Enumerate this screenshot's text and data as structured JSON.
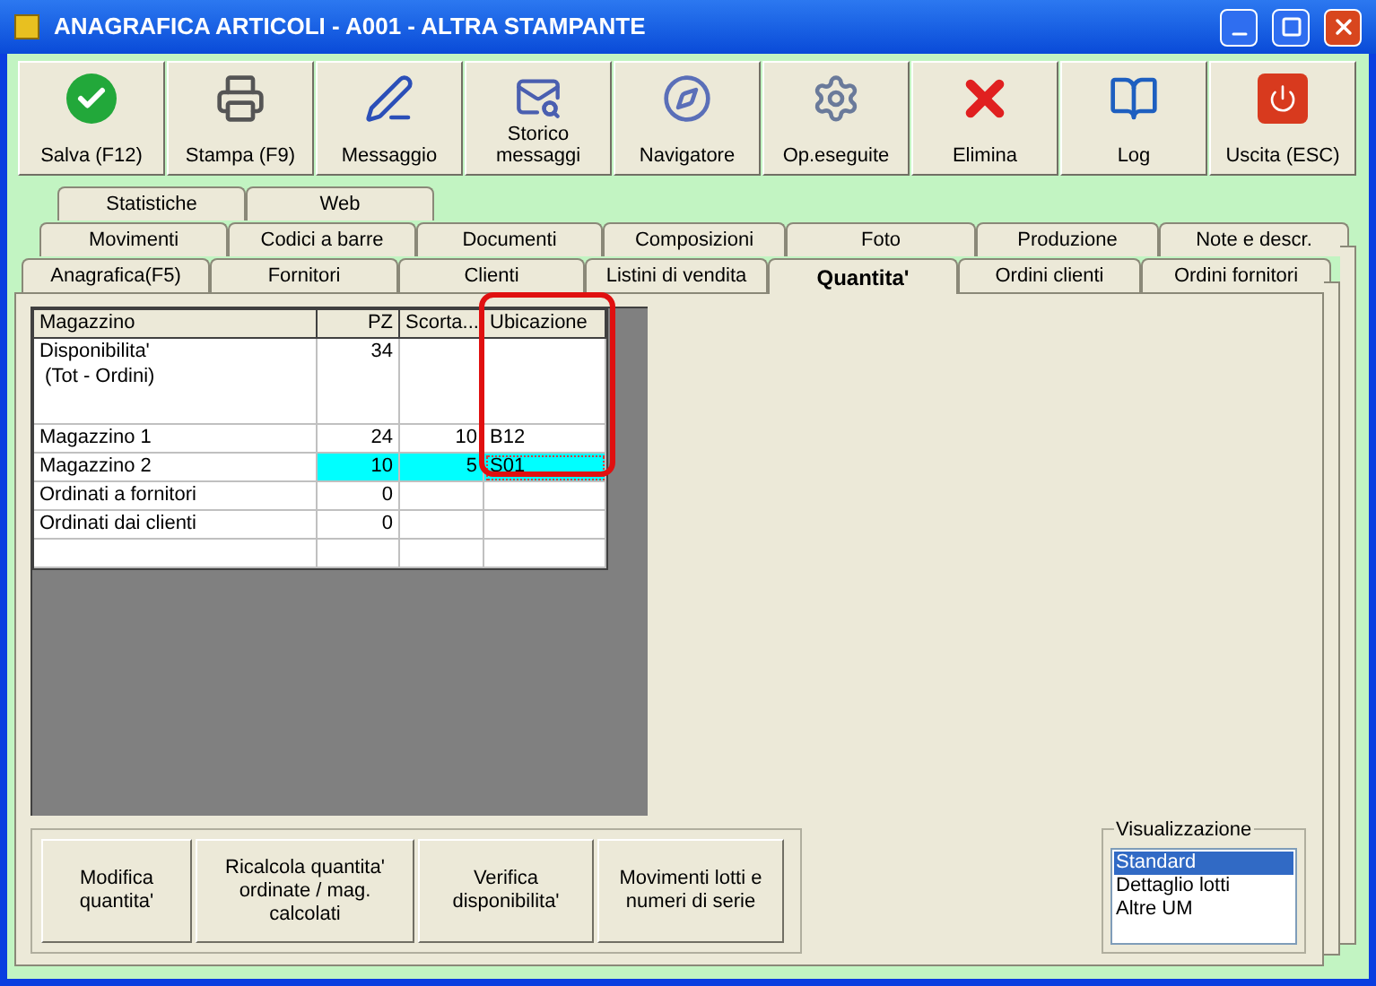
{
  "window": {
    "title": "ANAGRAFICA ARTICOLI - A001 - ALTRA STAMPANTE"
  },
  "toolbar": [
    {
      "label": "Salva (F12)"
    },
    {
      "label": "Stampa (F9)"
    },
    {
      "label": "Messaggio"
    },
    {
      "label": "Storico messaggi"
    },
    {
      "label": "Navigatore"
    },
    {
      "label": "Op.eseguite"
    },
    {
      "label": "Elimina"
    },
    {
      "label": "Log"
    },
    {
      "label": "Uscita (ESC)"
    }
  ],
  "tab_rows": [
    [
      {
        "label": "Statistiche",
        "selected": false
      },
      {
        "label": "Web",
        "selected": false
      }
    ],
    [
      {
        "label": "Movimenti",
        "selected": false
      },
      {
        "label": "Codici a barre",
        "selected": false
      },
      {
        "label": "Documenti",
        "selected": false
      },
      {
        "label": "Composizioni",
        "selected": false
      },
      {
        "label": "Foto",
        "selected": false
      },
      {
        "label": "Produzione",
        "selected": false
      },
      {
        "label": "Note e descr.",
        "selected": false
      }
    ],
    [
      {
        "label": "Anagrafica(F5)",
        "selected": false
      },
      {
        "label": "Fornitori",
        "selected": false
      },
      {
        "label": "Clienti",
        "selected": false
      },
      {
        "label": "Listini di vendita",
        "selected": false
      },
      {
        "label": "Quantita'",
        "selected": true
      },
      {
        "label": "Ordini clienti",
        "selected": false
      },
      {
        "label": "Ordini fornitori",
        "selected": false
      }
    ]
  ],
  "table": {
    "columns": [
      "Magazzino",
      "PZ",
      "Scorta...",
      "Ubicazione"
    ],
    "rows": [
      {
        "cells": [
          "Disponibilita'\n (Tot - Ordini)",
          "34",
          "",
          ""
        ],
        "selected": false
      },
      {
        "cells": [
          "Magazzino 1",
          "24",
          "10",
          "B12"
        ],
        "selected": false
      },
      {
        "cells": [
          "Magazzino 2",
          "10",
          "5",
          "S01"
        ],
        "selected": true
      },
      {
        "cells": [
          "Ordinati a fornitori",
          "0",
          "",
          ""
        ],
        "selected": false
      },
      {
        "cells": [
          "Ordinati dai clienti",
          "0",
          "",
          ""
        ],
        "selected": false
      },
      {
        "cells": [
          "",
          "",
          "",
          ""
        ],
        "selected": false
      }
    ]
  },
  "actions": [
    {
      "label": "Modifica\nquantita'"
    },
    {
      "label": "Ricalcola quantita'\nordinate / mag.\ncalcolati"
    },
    {
      "label": "Verifica\ndisponibilita'"
    },
    {
      "label": "Movimenti lotti e\nnumeri di serie"
    }
  ],
  "view": {
    "title": "Visualizzazione",
    "options": [
      {
        "label": "Standard",
        "selected": true
      },
      {
        "label": "Dettaglio lotti",
        "selected": false
      },
      {
        "label": "Altre UM",
        "selected": false
      }
    ]
  }
}
